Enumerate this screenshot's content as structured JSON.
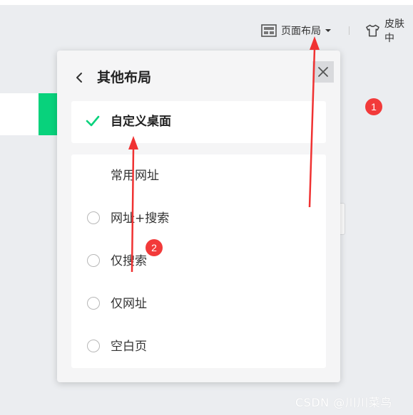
{
  "toolbar": {
    "layout_label": "页面布局",
    "skin_label": "皮肤中"
  },
  "panel": {
    "title": "其他布局",
    "selected_option": "自定义桌面",
    "options": [
      {
        "label": "常用网址",
        "has_radio": false
      },
      {
        "label": "网址+搜索",
        "has_radio": true
      },
      {
        "label": "仅搜索",
        "has_radio": true
      },
      {
        "label": "仅网址",
        "has_radio": true
      },
      {
        "label": "空白页",
        "has_radio": true
      }
    ]
  },
  "annotations": {
    "badge_1": "1",
    "badge_2": "2"
  },
  "watermark": "CSDN @川川菜鸟",
  "colors": {
    "accent_green": "#08d27c",
    "badge_red": "#f23a3a",
    "arrow_red": "#f03232"
  }
}
